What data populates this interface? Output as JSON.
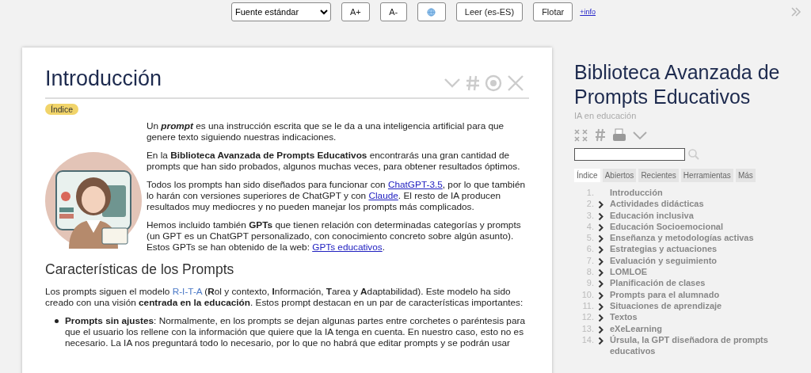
{
  "toolbar": {
    "font_select": "Fuente estándar",
    "buttons": [
      {
        "kind": "text",
        "label": "A+"
      },
      {
        "kind": "text",
        "label": "A-"
      },
      {
        "kind": "globe"
      },
      {
        "kind": "text",
        "label": "Leer (es-ES)"
      },
      {
        "kind": "text",
        "label": "Flotar"
      }
    ],
    "info_link": "+info"
  },
  "article": {
    "title": "Introducción",
    "index_badge": "Índice",
    "intro": [
      [
        {
          "kind": "text",
          "text": "Un "
        },
        {
          "kind": "strong_em",
          "text": "prompt"
        },
        {
          "kind": "text",
          "text": " es una instrucción escrita que se le da a una inteligencia artificial para que genere texto siguiendo nuestras indicaciones."
        }
      ],
      [
        {
          "kind": "text",
          "text": "En la **Biblioteca Avanzada de Prompts Educativos** encontrarás una gran cantidad de prompts que han sido probados, algunos muchas veces, para obtener resultados óptimos."
        }
      ],
      [
        {
          "kind": "text",
          "text": "Todos los prompts han sido diseñados para funcionar con "
        },
        {
          "kind": "link",
          "text": "ChatGPT-3.5"
        },
        {
          "kind": "text",
          "text": ", por lo que también lo harán con versiones superiores de ChatGPT y con "
        },
        {
          "kind": "link",
          "text": "Claude"
        },
        {
          "kind": "text",
          "text": ". El resto de IA producen resultados muy mediocres y no pueden manejar los prompts más complicados."
        }
      ],
      [
        {
          "kind": "text",
          "text": "Hemos incluido también **GPTs** que tienen relación con determinadas categorías y prompts (un GPT es un ChatGPT personalizado, con conocimiento concreto sobre algún asunto). Estos GPTs se han obtenido de la web: "
        },
        {
          "kind": "link",
          "text": "GPTs educativos"
        },
        {
          "kind": "text",
          "text": "."
        }
      ]
    ],
    "subtitle": "Características de los Prompts",
    "model_paragraph": [
      {
        "kind": "text",
        "text": "Los prompts siguen el modelo "
      },
      {
        "kind": "accent",
        "text": "R-I-T-A"
      },
      {
        "kind": "text",
        "text": " (**R**ol y contexto, **I**nformación, **T**area y **A**daptabilidad). Este modelo ha sido creado con una visión **centrada en la educación**. Estos prompt destacan en un par de características importantes:"
      }
    ],
    "bullets": [
      "**Prompts sin ajustes**: Normalmente, en los prompts se dejan algunas partes entre corchetes o paréntesis para que el usuario los rellene con la información que quiere que la IA tenga en cuenta. En nuestro caso, esto no es necesario. La IA nos preguntará todo lo necesario, por lo que no habrá que editar prompts y se podrán usar"
    ]
  },
  "sidebar": {
    "title": "Biblioteca Avanzada de Prompts Educativos",
    "subtitle": "IA en educación",
    "tabs": [
      {
        "label": "Índice",
        "selected": true
      },
      {
        "label": "Abiertos",
        "selected": false
      },
      {
        "label": "Recientes",
        "selected": false
      },
      {
        "label": "Herramientas",
        "selected": false
      },
      {
        "label": "Más",
        "selected": false
      }
    ],
    "toc": [
      {
        "number": "1.",
        "label": "Introducción",
        "expandable": false
      },
      {
        "number": "2.",
        "label": "Actividades didácticas",
        "expandable": true
      },
      {
        "number": "3.",
        "label": "Educación inclusiva",
        "expandable": true
      },
      {
        "number": "4.",
        "label": "Educación Socioemocional",
        "expandable": true
      },
      {
        "number": "5.",
        "label": "Enseñanza y metodologías activas",
        "expandable": true
      },
      {
        "number": "6.",
        "label": "Estrategias y actuaciones",
        "expandable": true
      },
      {
        "number": "7.",
        "label": "Evaluación y seguimiento",
        "expandable": true
      },
      {
        "number": "8.",
        "label": "LOMLOE",
        "expandable": true
      },
      {
        "number": "9.",
        "label": "Planificación de clases",
        "expandable": true
      },
      {
        "number": "10.",
        "label": "Prompts para el alumnado",
        "expandable": true
      },
      {
        "number": "11.",
        "label": "Situaciones de aprendizaje",
        "expandable": true
      },
      {
        "number": "12.",
        "label": "Textos",
        "expandable": true
      },
      {
        "number": "13.",
        "label": "eXeLearning",
        "expandable": true
      },
      {
        "number": "14.",
        "label": "Úrsula, la GPT diseñadora de prompts educativos",
        "expandable": true
      }
    ]
  }
}
